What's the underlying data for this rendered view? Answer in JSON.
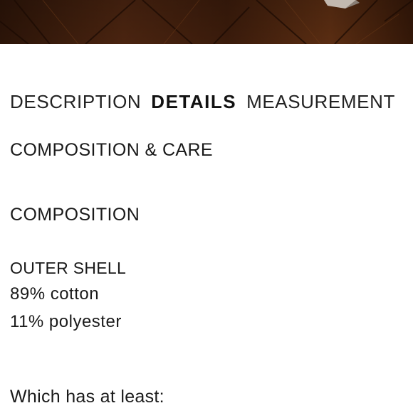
{
  "tabs": [
    {
      "label": "DESCRIPTION"
    },
    {
      "label": "DETAILS"
    },
    {
      "label": "MEASUREMENT"
    }
  ],
  "details": {
    "section_title": "COMPOSITION & CARE",
    "composition_title": "COMPOSITION",
    "part_title": "OUTER SHELL",
    "materials": [
      {
        "text": "89% cotton"
      },
      {
        "text": "11% polyester"
      }
    ],
    "note": "Which has at least:"
  },
  "colors": {
    "hero_dark": "#2b1408",
    "hero_mid": "#4a2410",
    "text": "#1a1a1a"
  }
}
